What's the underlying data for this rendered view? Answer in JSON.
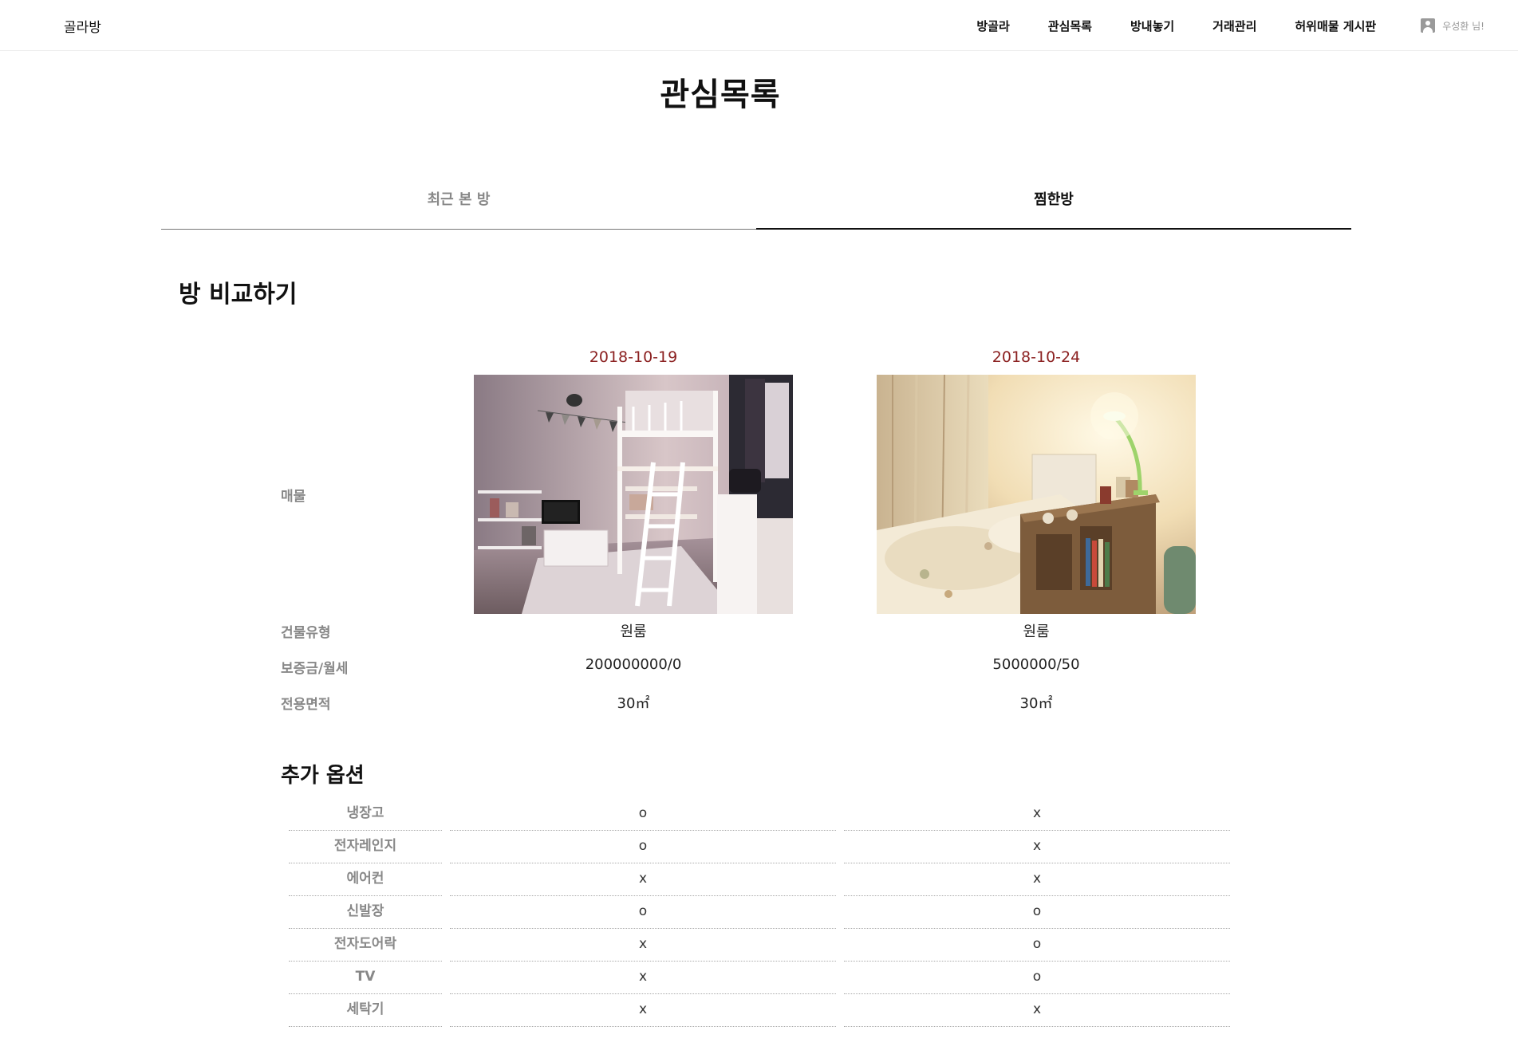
{
  "header": {
    "logo": "골라방",
    "nav": [
      "방골라",
      "관심목록",
      "방내놓기",
      "거래관리",
      "허위매물 게시판"
    ],
    "user": "우성환 님!"
  },
  "page_title": "관심목록",
  "tabs": {
    "recent": "최근 본 방",
    "liked": "찜한방",
    "active": "liked"
  },
  "compare": {
    "title": "방 비교하기",
    "labels": {
      "listing": "매물",
      "building_type": "건물유형",
      "deposit_rent": "보증금/월세",
      "area": "전용면적"
    },
    "rooms": [
      {
        "date": "2018-10-19",
        "building_type": "원룸",
        "deposit_rent": "200000000/0",
        "area": "30㎡",
        "photo_icon": "loft-room-photo"
      },
      {
        "date": "2018-10-24",
        "building_type": "원룸",
        "deposit_rent": "5000000/50",
        "area": "30㎡",
        "photo_icon": "bedroom-lamp-photo"
      }
    ],
    "accent_color": "#8b2020"
  },
  "options": {
    "title": "추가 옵션",
    "rows": [
      {
        "name": "냉장고",
        "values": [
          "o",
          "x"
        ]
      },
      {
        "name": "전자레인지",
        "values": [
          "o",
          "x"
        ]
      },
      {
        "name": "에어컨",
        "values": [
          "x",
          "x"
        ]
      },
      {
        "name": "신발장",
        "values": [
          "o",
          "o"
        ]
      },
      {
        "name": "전자도어락",
        "values": [
          "x",
          "o"
        ]
      },
      {
        "name": "TV",
        "values": [
          "x",
          "o"
        ]
      },
      {
        "name": "세탁기",
        "values": [
          "x",
          "x"
        ]
      }
    ]
  }
}
